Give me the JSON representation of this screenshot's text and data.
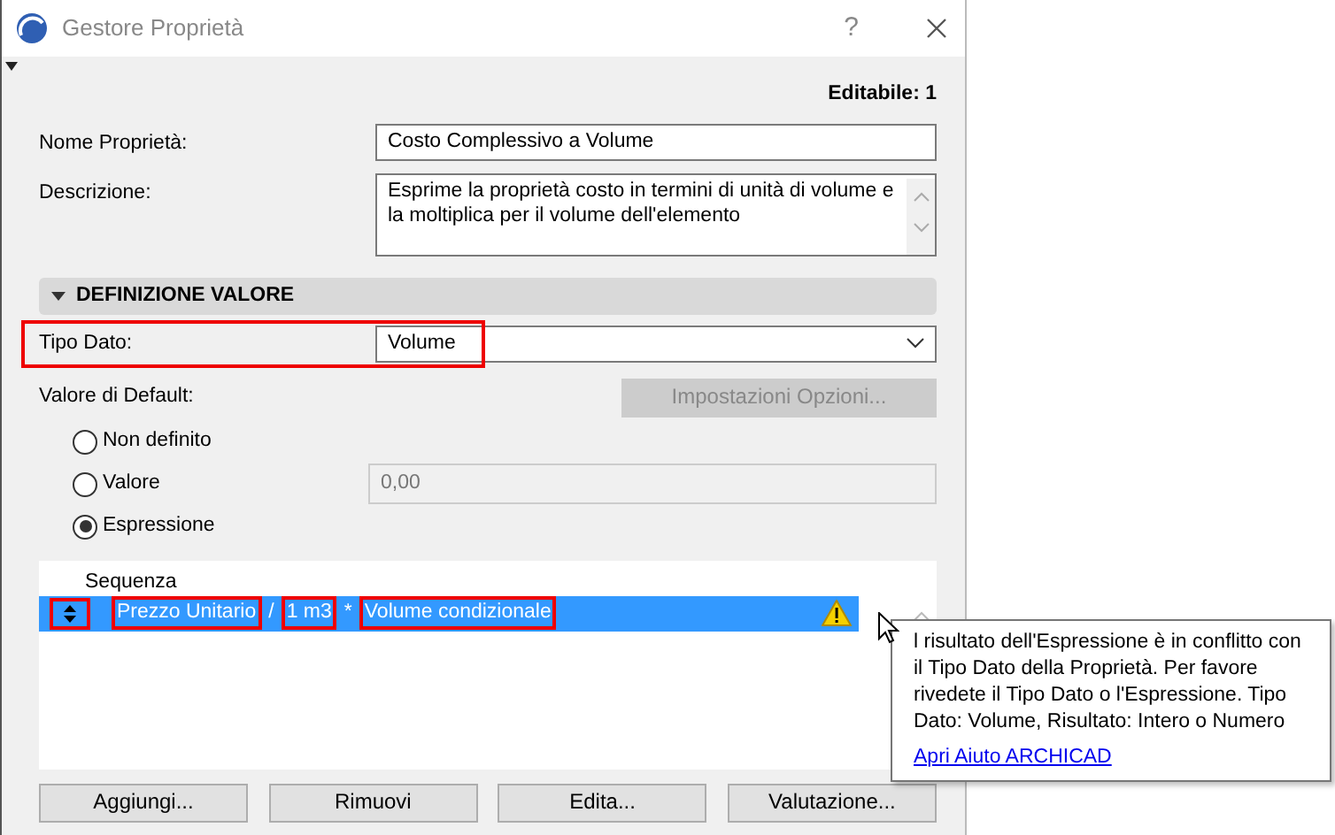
{
  "window": {
    "title": "Gestore Proprietà",
    "help": "?"
  },
  "editable": "Editabile: 1",
  "fields": [
    {
      "kind": "text",
      "label": "Nome Proprietà:",
      "value": "Costo Complessivo a Volume"
    },
    {
      "kind": "textarea",
      "label": "Descrizione:",
      "value": "Esprime la proprietà costo in termini di unità di volume e la moltiplica per il volume dell'elemento"
    }
  ],
  "section": {
    "title": "DEFINIZIONE VALORE",
    "expanded": true
  },
  "data_type": {
    "label": "Tipo Dato:",
    "value": "Volume",
    "highlighted": true
  },
  "default_value": {
    "label": "Valore di Default:",
    "options_button": {
      "label": "Impostazioni Opzioni...",
      "disabled": true
    }
  },
  "radios": [
    {
      "label": "Non definito",
      "selected": false
    },
    {
      "label": "Valore",
      "selected": false,
      "value": "0,00",
      "value_disabled": true
    },
    {
      "label": "Espressione",
      "selected": true
    }
  ],
  "expression_table": {
    "column": "Sequenza",
    "rows": [
      {
        "selected": true,
        "warning": true,
        "parts": [
          {
            "text": "Prezzo Unitario",
            "highlighted": true
          },
          {
            "text": "/",
            "highlighted": false
          },
          {
            "text": "1 m3",
            "highlighted": true
          },
          {
            "text": "*",
            "highlighted": false
          },
          {
            "text": "Volume condizionale",
            "highlighted": true
          }
        ]
      }
    ]
  },
  "buttons": [
    "Aggiungi...",
    "Rimuovi",
    "Edita...",
    "Valutazione..."
  ],
  "tooltip": {
    "text": "l risultato dell'Espressione è in conflitto con il Tipo Dato della Proprietà. Per favore rivedete il Tipo Dato o l'Espressione. Tipo Dato: Volume, Risultato: Intero o Numero",
    "link": "Apri Aiuto ARCHICAD"
  }
}
